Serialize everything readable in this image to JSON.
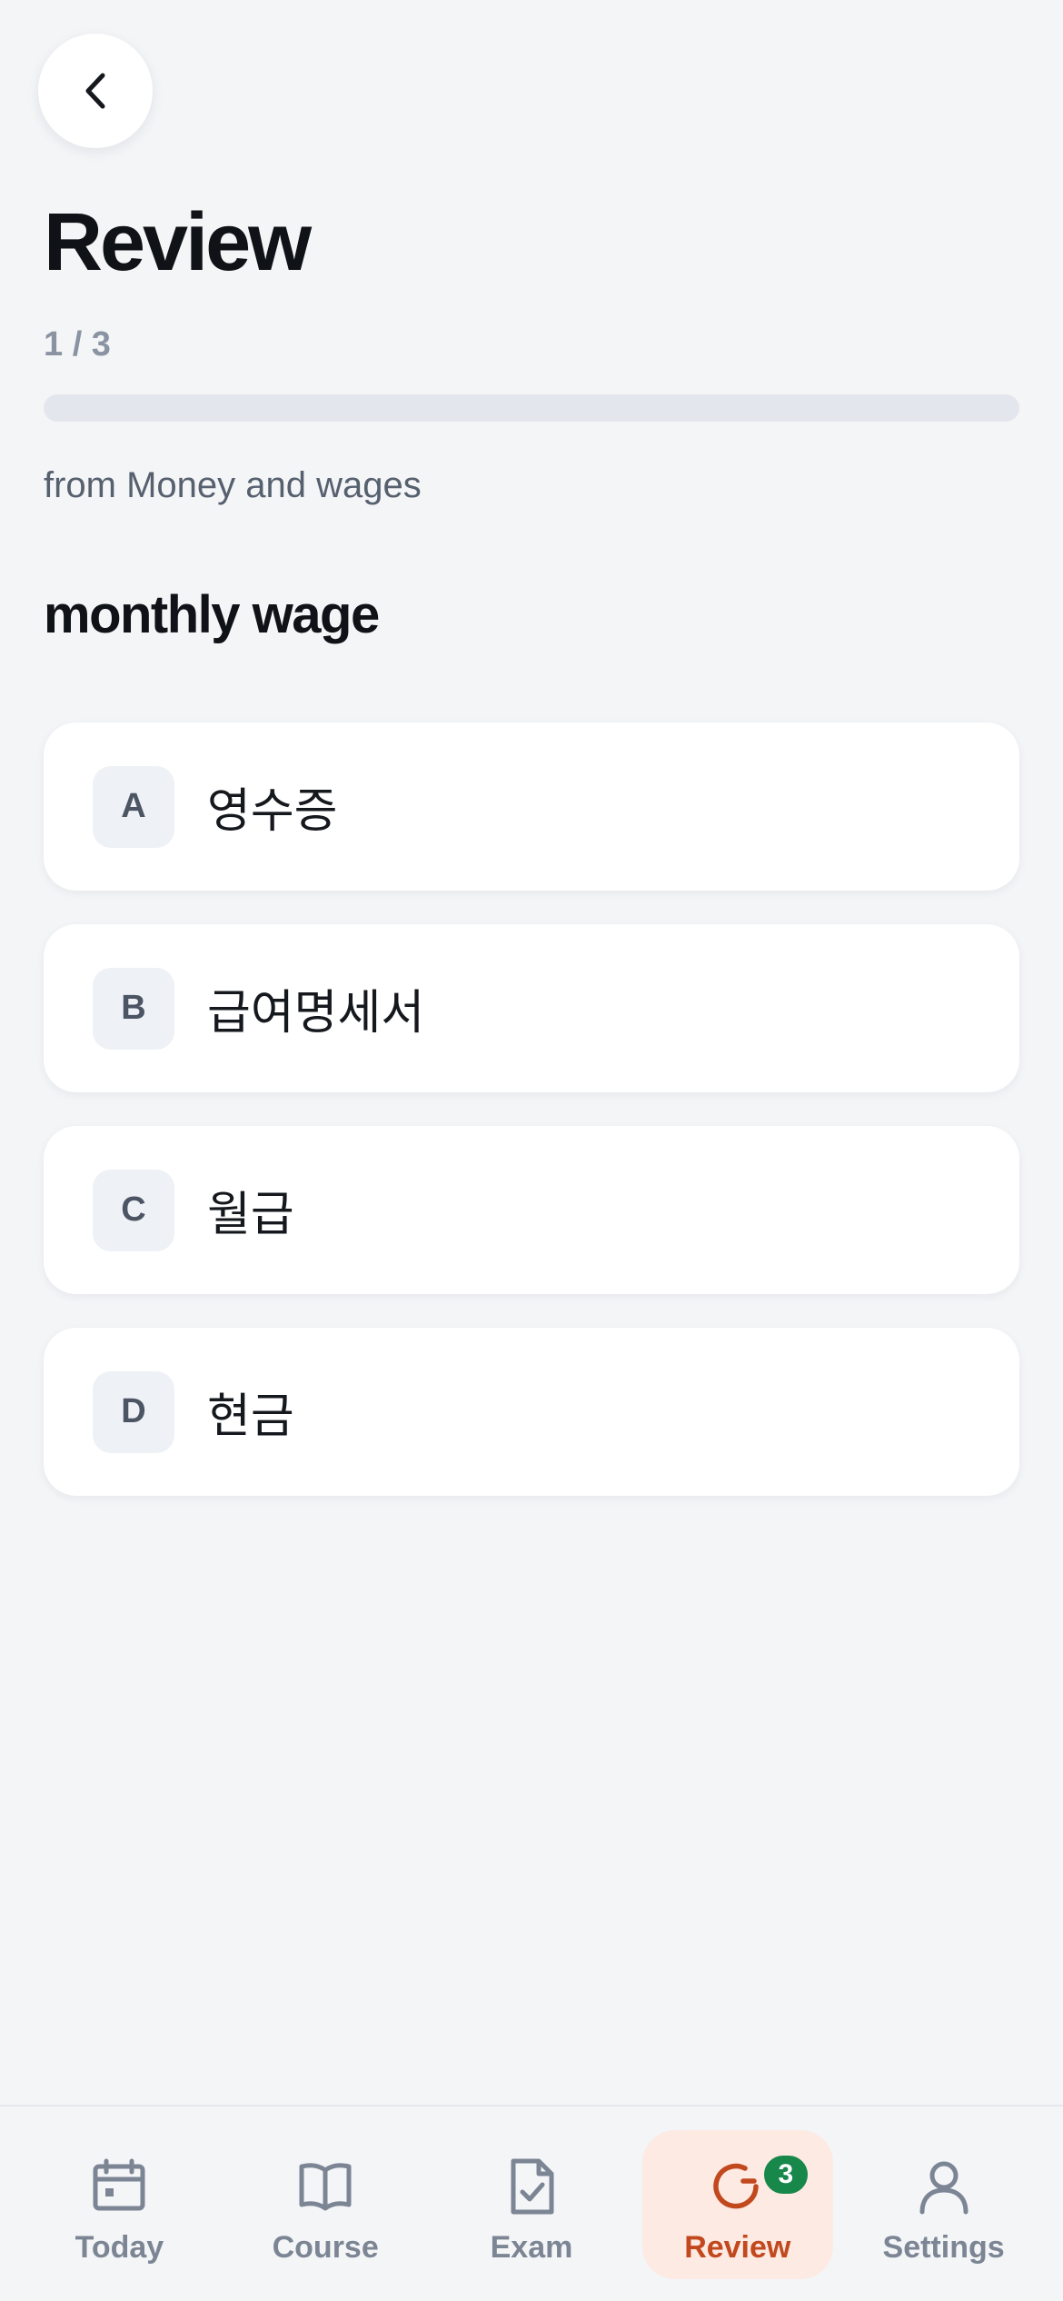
{
  "header": {
    "title": "Review",
    "counter": "1 / 3",
    "progress_fraction": 0,
    "source": "from Money and wages"
  },
  "question": {
    "prompt": "monthly wage",
    "options": [
      {
        "letter": "A",
        "text": "영수증"
      },
      {
        "letter": "B",
        "text": "급여명세서"
      },
      {
        "letter": "C",
        "text": "월급"
      },
      {
        "letter": "D",
        "text": "현금"
      }
    ]
  },
  "tabs": [
    {
      "label": "Today",
      "icon": "calendar-icon"
    },
    {
      "label": "Course",
      "icon": "book-icon"
    },
    {
      "label": "Exam",
      "icon": "document-check-icon"
    },
    {
      "label": "Review",
      "icon": "refresh-icon",
      "badge": "3",
      "active": true
    },
    {
      "label": "Settings",
      "icon": "user-icon"
    }
  ],
  "colors": {
    "accent": "#c2481d",
    "active_tab_bg": "#fdeae3",
    "badge_bg": "#17874a",
    "background": "#f4f5f7"
  }
}
